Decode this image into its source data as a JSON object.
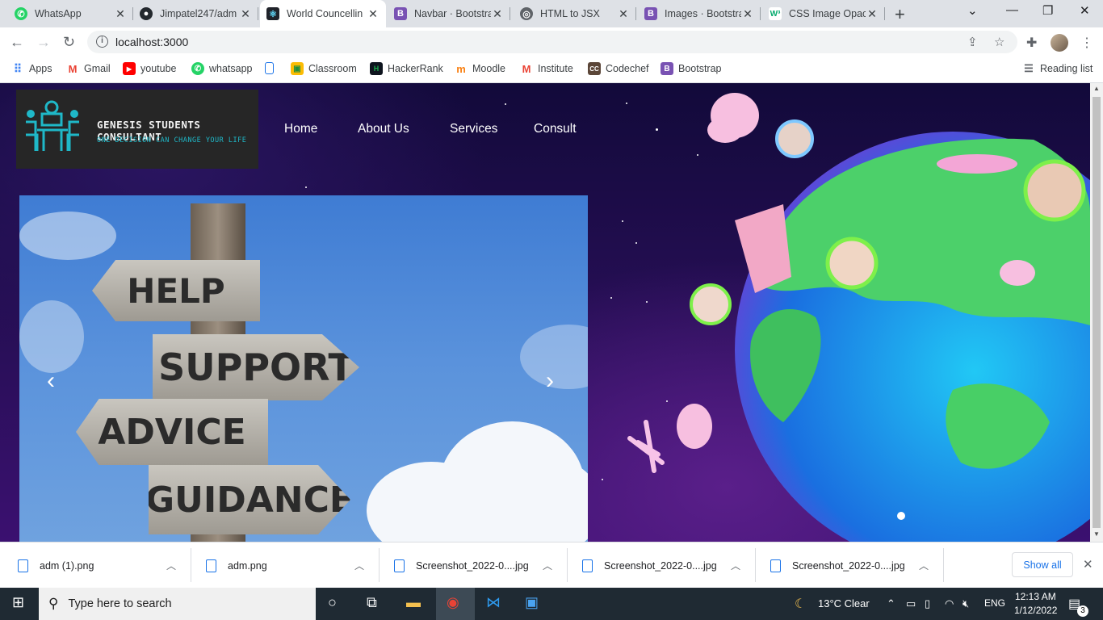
{
  "tabs": [
    {
      "title": "WhatsApp",
      "icon": "whatsapp-icon",
      "color": "#25d366"
    },
    {
      "title": "Jimpatel247/adm",
      "icon": "github-icon",
      "color": "#24292e"
    },
    {
      "title": "World Councellin",
      "icon": "react-icon",
      "color": "#20232a"
    },
    {
      "title": "Navbar · Bootstra",
      "icon": "bootstrap-icon",
      "color": "#7952b3"
    },
    {
      "title": "HTML to JSX",
      "icon": "globe-icon",
      "color": "#5f6368"
    },
    {
      "title": "Images · Bootstra",
      "icon": "bootstrap-icon",
      "color": "#7952b3"
    },
    {
      "title": "CSS Image Opac",
      "icon": "w3schools-icon",
      "color": "#04aa6d"
    }
  ],
  "address": {
    "url": "localhost:3000"
  },
  "bookmarks": [
    {
      "label": "Apps",
      "icon": "apps-grid-icon",
      "color": "#4285f4"
    },
    {
      "label": "Gmail",
      "icon": "gmail-icon",
      "color": "#ea4335"
    },
    {
      "label": "youtube",
      "icon": "youtube-icon",
      "color": "#ff0000"
    },
    {
      "label": "whatsapp",
      "icon": "whatsapp-icon",
      "color": "#25d366"
    },
    {
      "label": "",
      "icon": "bookmark-page-icon",
      "color": "#1a73e8"
    },
    {
      "label": "Classroom",
      "icon": "classroom-icon",
      "color": "#fbbc04"
    },
    {
      "label": "HackerRank",
      "icon": "hackerrank-icon",
      "color": "#1ba94c"
    },
    {
      "label": "Moodle",
      "icon": "moodle-icon",
      "color": "#f98012"
    },
    {
      "label": "Institute",
      "icon": "gmail-icon",
      "color": "#ea4335"
    },
    {
      "label": "Codechef",
      "icon": "codechef-icon",
      "color": "#5b4638"
    },
    {
      "label": "Bootstrap",
      "icon": "bootstrap-icon",
      "color": "#7952b3"
    }
  ],
  "reading_list": "Reading list",
  "site": {
    "brand_title": "GENESIS STUDENTS CONSULTANT",
    "brand_tagline": "ONE DECISION CAN CHANGE YOUR LIFE",
    "nav": [
      "Home",
      "About Us",
      "Services",
      "Consult"
    ],
    "signs": [
      "HELP",
      "SUPPORT",
      "ADVICE",
      "GUIDANCE"
    ]
  },
  "downloads": {
    "items": [
      "adm (1).png",
      "adm.png",
      "Screenshot_2022-0....jpg",
      "Screenshot_2022-0....jpg",
      "Screenshot_2022-0....jpg"
    ],
    "show_all": "Show all"
  },
  "taskbar": {
    "search_placeholder": "Type here to search",
    "weather": "13°C  Clear",
    "lang": "ENG",
    "time": "12:13 AM",
    "date": "1/12/2022",
    "notifications": "3"
  }
}
